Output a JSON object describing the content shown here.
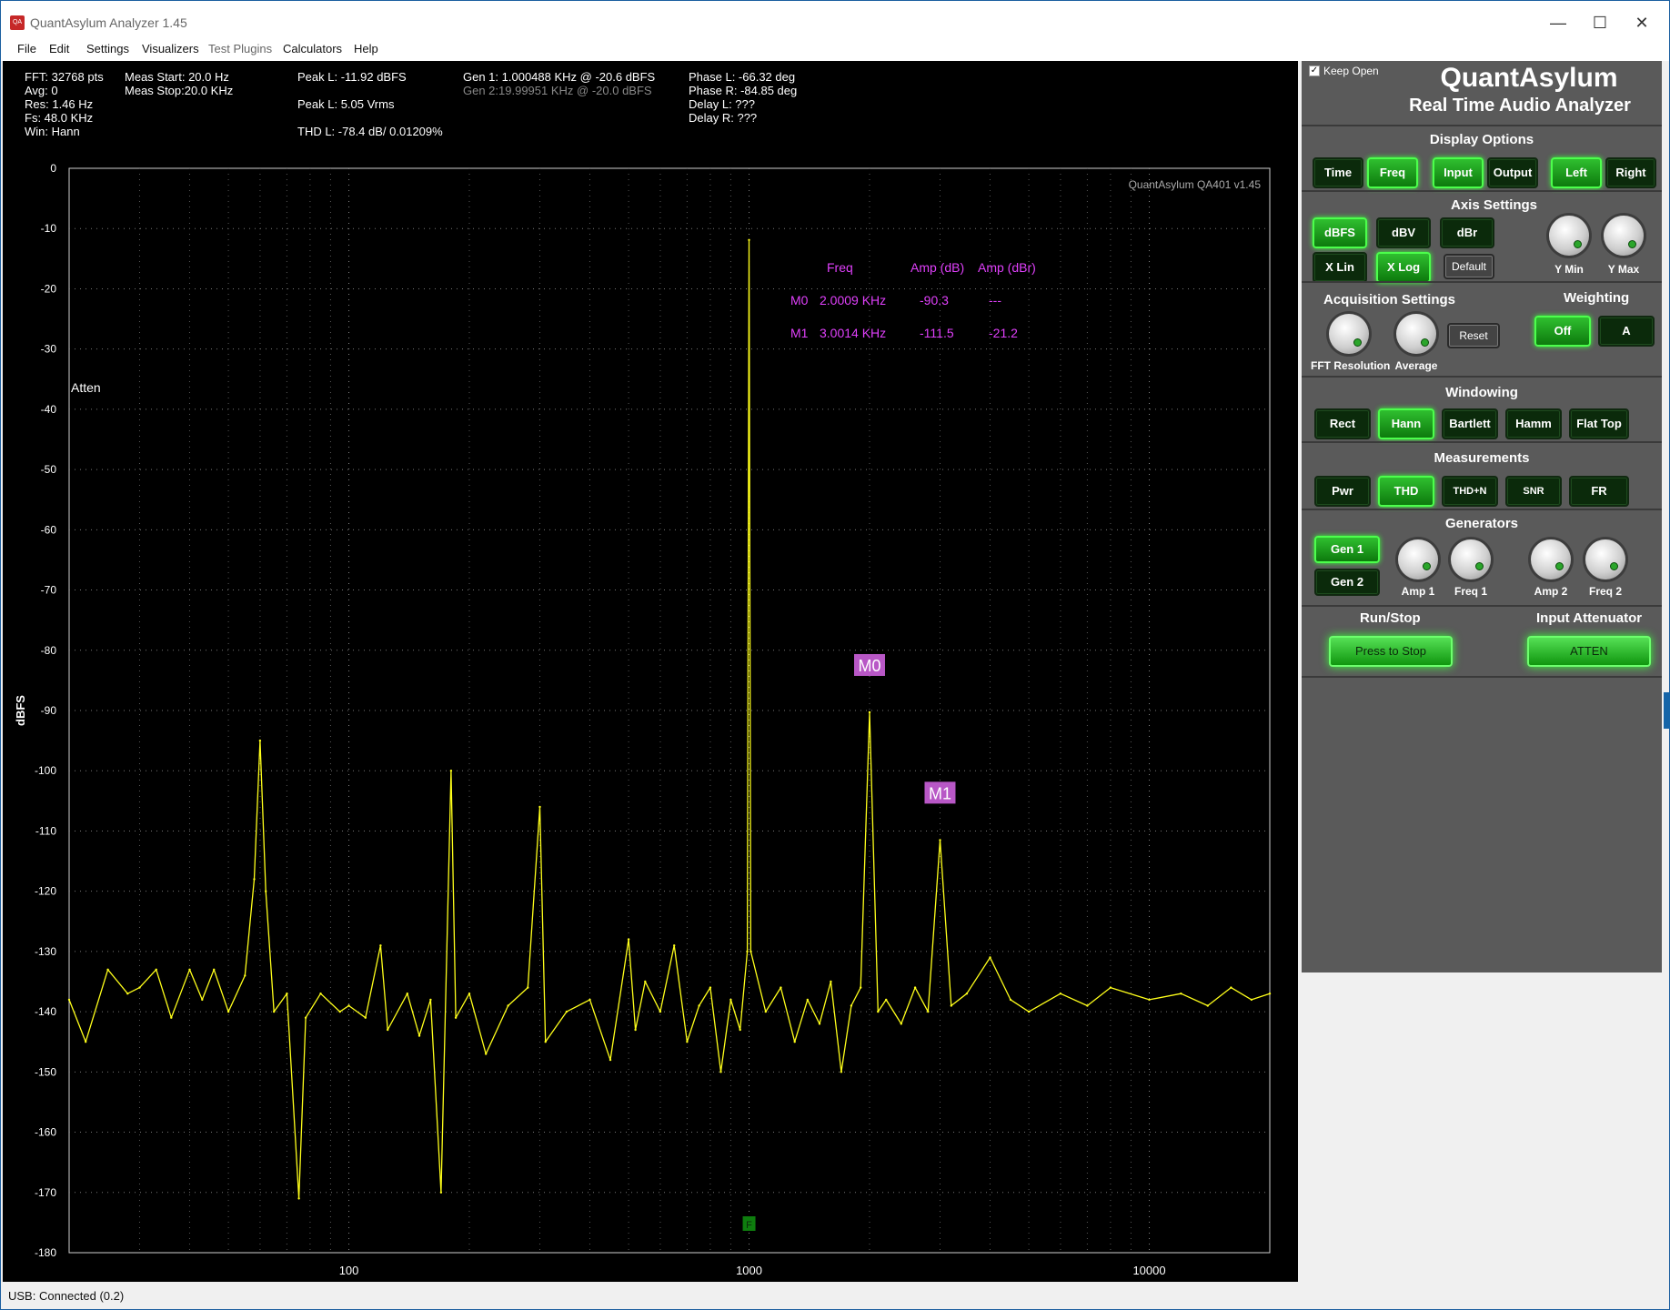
{
  "window": {
    "title": "QuantAsylum Analyzer 1.45",
    "icon_text": "QA",
    "minimize_glyph": "—",
    "maximize_glyph": "☐",
    "close_glyph": "✕"
  },
  "menu": [
    "File",
    "Edit",
    "Settings",
    "Visualizers",
    "Test Plugins",
    "Calculators",
    "Help"
  ],
  "stats": {
    "fft": "FFT: 32768 pts",
    "avg": "Avg: 0",
    "res": "Res: 1.46 Hz",
    "fs": "Fs: 48.0 KHz",
    "win": "Win: Hann",
    "meas_start": "Meas Start: 20.0 Hz",
    "meas_stop": "Meas Stop:20.0 KHz",
    "peak_dbfs": "Peak L: -11.92 dBFS",
    "peak_vrms": "Peak L: 5.05 Vrms",
    "thd": "THD L: -78.4 dB/ 0.01209%",
    "gen1": "Gen 1: 1.000488 KHz @ -20.6  dBFS",
    "gen2": "Gen 2:19.99951 KHz @ -20.0  dBFS",
    "phase_l": "Phase L: -66.32 deg",
    "phase_r": "Phase R: -84.85 deg",
    "delay_l": "Delay L: ???",
    "delay_r": "Delay R: ???"
  },
  "plot": {
    "watermark": "QuantAsylum QA401 v1.45",
    "atten_label": "Atten",
    "f_marker": "F",
    "marker_table": {
      "headers": [
        "Freq",
        "Amp (dB)",
        "Amp (dBr)"
      ],
      "rows": [
        {
          "name": "M0",
          "freq": "2.0009 KHz",
          "amp": "-90.3",
          "ampr": "---"
        },
        {
          "name": "M1",
          "freq": "3.0014 KHz",
          "amp": "-111.5",
          "ampr": "-21.2"
        }
      ]
    }
  },
  "chart_data": {
    "type": "line",
    "xscale": "log",
    "xlim": [
      20,
      20000
    ],
    "ylim": [
      -180,
      0
    ],
    "ylabel": "dBFS",
    "xticks": [
      "100",
      "1000",
      "10000"
    ],
    "yticks": [
      "0",
      "-10",
      "-20",
      "-30",
      "-40",
      "-50",
      "-60",
      "-70",
      "-80",
      "-90",
      "-100",
      "-110",
      "-120",
      "-130",
      "-140",
      "-150",
      "-160",
      "-170",
      "-180"
    ],
    "grid": true,
    "series": [
      {
        "color": "#ffff1a",
        "points": [
          [
            20,
            -138
          ],
          [
            22,
            -145
          ],
          [
            25,
            -133
          ],
          [
            28,
            -137
          ],
          [
            30,
            -136
          ],
          [
            33,
            -133
          ],
          [
            36,
            -141
          ],
          [
            40,
            -133
          ],
          [
            43,
            -138
          ],
          [
            46,
            -133
          ],
          [
            50,
            -140
          ],
          [
            55,
            -134
          ],
          [
            58,
            -118
          ],
          [
            60,
            -95
          ],
          [
            62,
            -120
          ],
          [
            65,
            -140
          ],
          [
            70,
            -137
          ],
          [
            75,
            -171
          ],
          [
            78,
            -141
          ],
          [
            85,
            -137
          ],
          [
            95,
            -140
          ],
          [
            100,
            -139
          ],
          [
            110,
            -141
          ],
          [
            120,
            -129
          ],
          [
            125,
            -143
          ],
          [
            140,
            -137
          ],
          [
            150,
            -144
          ],
          [
            160,
            -138
          ],
          [
            170,
            -170
          ],
          [
            180,
            -100
          ],
          [
            185,
            -141
          ],
          [
            200,
            -137
          ],
          [
            220,
            -147
          ],
          [
            250,
            -139
          ],
          [
            280,
            -136
          ],
          [
            300,
            -106
          ],
          [
            310,
            -145
          ],
          [
            350,
            -140
          ],
          [
            400,
            -138
          ],
          [
            450,
            -148
          ],
          [
            500,
            -128
          ],
          [
            520,
            -143
          ],
          [
            550,
            -135
          ],
          [
            600,
            -140
          ],
          [
            650,
            -129
          ],
          [
            700,
            -145
          ],
          [
            750,
            -139
          ],
          [
            800,
            -136
          ],
          [
            850,
            -150
          ],
          [
            900,
            -138
          ],
          [
            950,
            -143
          ],
          [
            990,
            -130
          ],
          [
            1000,
            -11.9
          ],
          [
            1010,
            -130
          ],
          [
            1100,
            -140
          ],
          [
            1200,
            -136
          ],
          [
            1300,
            -145
          ],
          [
            1400,
            -138
          ],
          [
            1500,
            -142
          ],
          [
            1600,
            -135
          ],
          [
            1700,
            -150
          ],
          [
            1800,
            -139
          ],
          [
            1900,
            -136
          ],
          [
            2000,
            -90.3
          ],
          [
            2100,
            -140
          ],
          [
            2200,
            -138
          ],
          [
            2400,
            -142
          ],
          [
            2600,
            -136
          ],
          [
            2800,
            -140
          ],
          [
            3000,
            -111.5
          ],
          [
            3200,
            -139
          ],
          [
            3500,
            -137
          ],
          [
            4000,
            -131
          ],
          [
            4500,
            -138
          ],
          [
            5000,
            -140
          ],
          [
            6000,
            -137
          ],
          [
            7000,
            -139
          ],
          [
            8000,
            -136
          ],
          [
            10000,
            -138
          ],
          [
            12000,
            -137
          ],
          [
            14000,
            -139
          ],
          [
            16000,
            -136
          ],
          [
            18000,
            -138
          ],
          [
            20000,
            -137
          ]
        ]
      }
    ],
    "markers": [
      {
        "name": "M0",
        "x": 2000,
        "y": -90.3
      },
      {
        "name": "M1",
        "x": 3000,
        "y": -111.5
      }
    ]
  },
  "panel": {
    "keep_open": "Keep Open",
    "brand": "QuantAsylum",
    "subtitle": "Real Time Audio Analyzer",
    "display_options": {
      "title": "Display Options",
      "buttons": [
        "Time",
        "Freq",
        "Input",
        "Output",
        "Left",
        "Right"
      ]
    },
    "axis_settings": {
      "title": "Axis Settings",
      "buttons": [
        "dBFS",
        "dBV",
        "dBr",
        "X Lin",
        "X Log",
        "Default"
      ],
      "knobs": [
        "Y Min",
        "Y Max"
      ]
    },
    "acquisition": {
      "title": "Acquisition Settings",
      "knobs": [
        "FFT Resolution",
        "Average"
      ],
      "reset": "Reset"
    },
    "weighting": {
      "title": "Weighting",
      "buttons": [
        "Off",
        "A"
      ]
    },
    "windowing": {
      "title": "Windowing",
      "buttons": [
        "Rect",
        "Hann",
        "Bartlett",
        "Hamm",
        "Flat Top"
      ]
    },
    "measurements": {
      "title": "Measurements",
      "buttons": [
        "Pwr",
        "THD",
        "THD+N",
        "SNR",
        "FR"
      ]
    },
    "generators": {
      "title": "Generators",
      "buttons": [
        "Gen 1",
        "Gen 2"
      ],
      "knobs": [
        "Amp 1",
        "Freq 1",
        "Amp 2",
        "Freq 2"
      ]
    },
    "run_stop": {
      "title": "Run/Stop",
      "button": "Press to Stop"
    },
    "input_attenuator": {
      "title": "Input Attenuator",
      "button": "ATTEN"
    }
  },
  "status": {
    "text": "USB: Connected  (0.2)"
  },
  "colors": {
    "trace": "#ffff1a",
    "marker": "#e040fb",
    "button_on": "#2fbf2f",
    "panel": "#5a5a5a"
  }
}
